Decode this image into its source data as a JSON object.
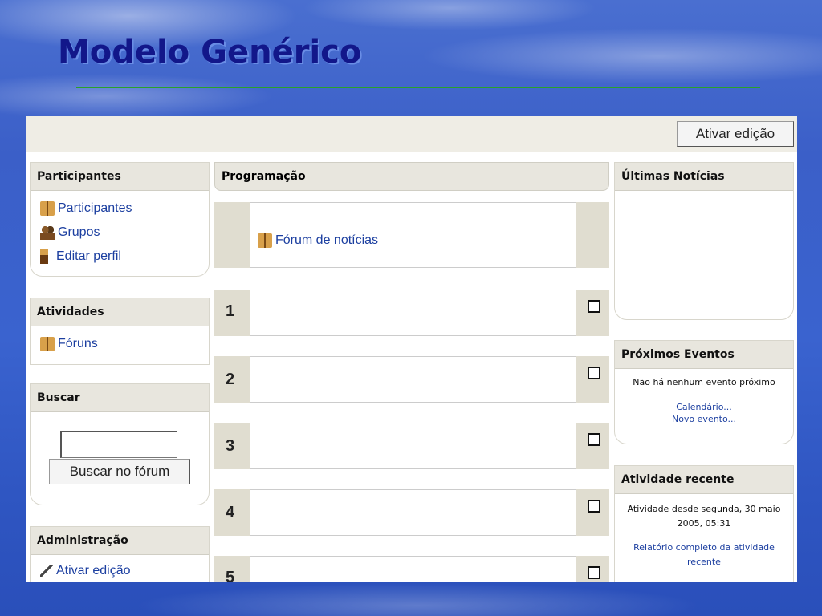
{
  "slide": {
    "title": "Modelo Genérico"
  },
  "topbar": {
    "edit_button": "Ativar edição"
  },
  "participants": {
    "title": "Participantes",
    "items": [
      "Participantes",
      "Grupos",
      "Editar perfil"
    ]
  },
  "activities": {
    "title": "Atividades",
    "items": [
      "Fóruns"
    ]
  },
  "search": {
    "title": "Buscar",
    "input_value": "",
    "button": "Buscar no fórum"
  },
  "admin": {
    "title": "Administração",
    "items": [
      "Ativar edição"
    ]
  },
  "program": {
    "title": "Programação",
    "news_forum": "Fórum de notícias",
    "sections": [
      "1",
      "2",
      "3",
      "4",
      "5"
    ]
  },
  "news": {
    "title": "Últimas Notícias"
  },
  "events": {
    "title": "Próximos Eventos",
    "empty_text": "Não há nenhum evento próximo",
    "calendar_link": "Calendário...",
    "new_event_link": "Novo evento..."
  },
  "recent": {
    "title": "Atividade recente",
    "since_text": "Atividade desde segunda, 30 maio 2005, 05:31",
    "full_report_link": "Relatório completo da atividade recente"
  },
  "icons": [
    "participants-icon",
    "groups-icon",
    "edit-profile-icon",
    "forum-icon",
    "edit-pencil-icon"
  ]
}
